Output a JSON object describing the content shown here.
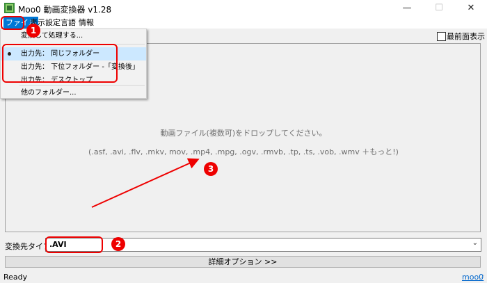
{
  "window": {
    "title": "Moo0 動画変換器 v1.28",
    "min_glyph": "—",
    "max_glyph": "☐",
    "close_glyph": "✕"
  },
  "menubar": {
    "items": [
      {
        "label": "ファイル"
      },
      {
        "label": "表示設定"
      },
      {
        "label": "言語"
      },
      {
        "label": "情報"
      }
    ]
  },
  "file_menu": {
    "items": [
      {
        "label": "変換して処理する..."
      },
      {
        "label": "出力先： 同じフォルダー",
        "selected": true
      },
      {
        "label": "出力先： 下位フォルダー -「変換後」"
      },
      {
        "label": "出力先： デスクトップ"
      },
      {
        "label": "他のフォルダー..."
      }
    ]
  },
  "topmost": {
    "label": "最前面表示",
    "checked": false
  },
  "drop_area": {
    "instruction": "動画ファイル(複数可)をドロップしてください。",
    "formats": "(.asf, .avi, .flv, .mkv, mov, .mp4, .mpg, .ogv, .rmvb, .tp, .ts, .vob, .wmv ＋もっと!)"
  },
  "output_type": {
    "label": "変換先タイプ:",
    "value": ".AVI"
  },
  "detail_button": {
    "label": "詳細オプション >>"
  },
  "status": {
    "text": "Ready",
    "link": "moo0"
  },
  "annotations": [
    "1",
    "2",
    "3"
  ],
  "colors": {
    "accent": "#0078d7",
    "annotation": "#e00000",
    "selected_bg": "#cce8ff"
  }
}
